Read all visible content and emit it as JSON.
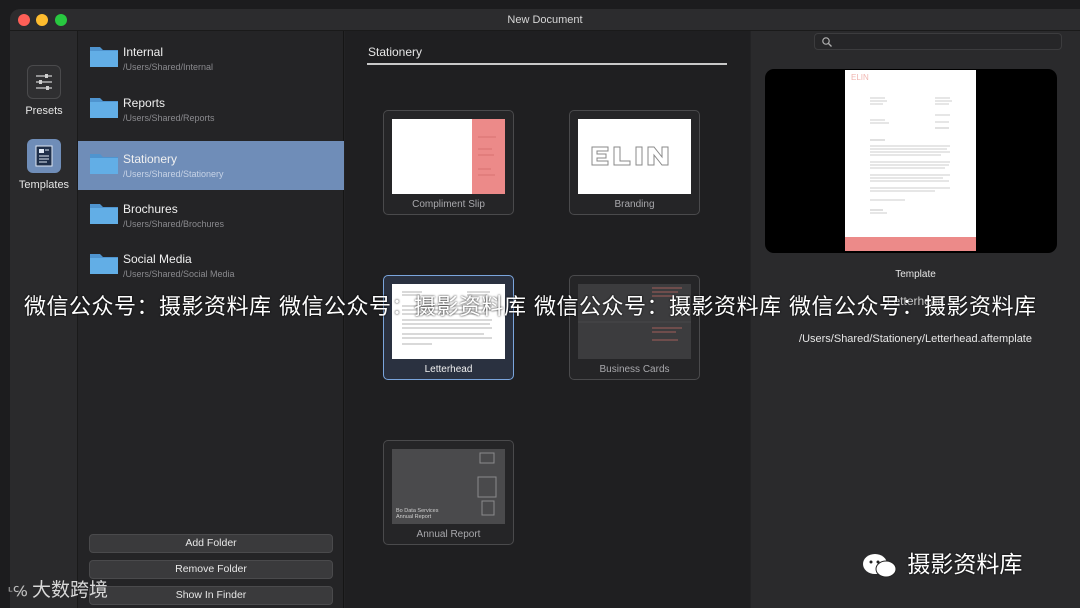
{
  "window": {
    "title": "New Document"
  },
  "rail": {
    "presets_label": "Presets",
    "templates_label": "Templates"
  },
  "folders": [
    {
      "name": "Internal",
      "path": "/Users/Shared/Internal"
    },
    {
      "name": "Reports",
      "path": "/Users/Shared/Reports"
    },
    {
      "name": "Stationery",
      "path": "/Users/Shared/Stationery"
    },
    {
      "name": "Brochures",
      "path": "/Users/Shared/Brochures"
    },
    {
      "name": "Social Media",
      "path": "/Users/Shared/Social Media"
    }
  ],
  "folder_buttons": {
    "add": "Add Folder",
    "remove": "Remove Folder",
    "finder": "Show In Finder"
  },
  "gallery": {
    "section_title": "Stationery",
    "tiles": [
      {
        "label": "Compliment Slip"
      },
      {
        "label": "Branding"
      },
      {
        "label": "Letterhead"
      },
      {
        "label": "Business Cards"
      },
      {
        "label": "Annual Report"
      }
    ],
    "annual_report_thumb_text": "Bo Data Services\nAnnual Report"
  },
  "search": {
    "placeholder": ""
  },
  "preview": {
    "kind": "Template",
    "name": "Letterhead",
    "path": "/Users/Shared/Stationery/Letterhead.aftemplate"
  },
  "watermark": {
    "overlay": "微信公众号：摄影资料库  微信公众号：摄影资料库  微信公众号：摄影资料库  微信公众号：摄影资料库",
    "bottom_right": "摄影资料库",
    "bottom_left": "大数跨境"
  },
  "colors": {
    "accent_selected": "#6f8db8",
    "folder_blue": "#5aa6df",
    "brand_salmon": "#e8706f"
  }
}
